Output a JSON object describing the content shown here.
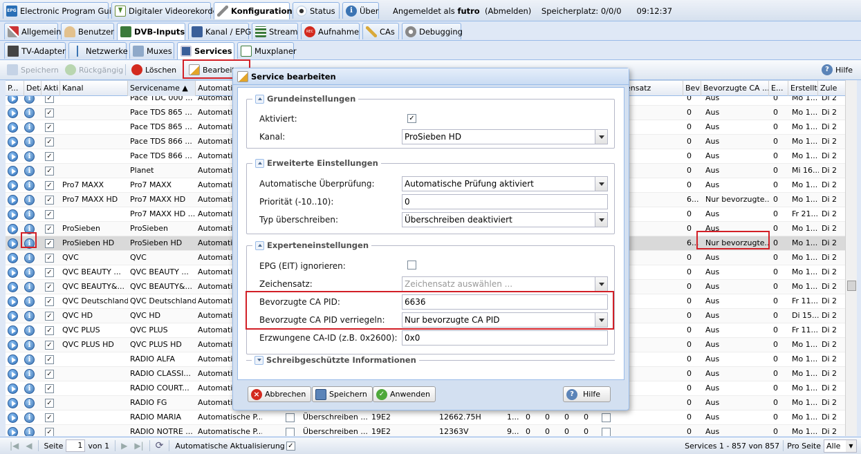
{
  "topnav": {
    "tabs": [
      {
        "label": "Electronic Program Guide",
        "icon": "epg-icon"
      },
      {
        "label": "Digitaler Videorekorder",
        "icon": "download-icon"
      },
      {
        "label": "Konfiguration",
        "icon": "wrench-icon"
      },
      {
        "label": "Status",
        "icon": "eye-icon"
      },
      {
        "label": "Über",
        "icon": "info-icon"
      }
    ],
    "logged_in": "Angemeldet als",
    "user": "futro",
    "logout": "(Abmelden)",
    "storage": "Speicherplatz: 0/0/0",
    "time": "09:12:37"
  },
  "config_tabs": [
    "Allgemein",
    "Benutzer",
    "DVB-Inputs",
    "Kanal / EPG",
    "Stream",
    "Aufnahme",
    "CAs",
    "Debugging"
  ],
  "dvb_tabs": [
    "TV-Adapter",
    "Netzwerke",
    "Muxes",
    "Services",
    "Muxplaner"
  ],
  "toolbar": {
    "save": "Speichern",
    "undo": "Rückgängig",
    "delete": "Löschen",
    "edit": "Bearbeiten",
    "help": "Hilfe"
  },
  "columns": [
    "P...",
    "Deta",
    "Akti",
    "Kanal",
    "Servicename ▲",
    "Automatis",
    "",
    "",
    "",
    "",
    "",
    "",
    "",
    "",
    "chensatz",
    "Bev",
    "Bevorzugte CA ...",
    "E...",
    "Erstellt",
    "Zule"
  ],
  "rows": [
    {
      "kanal": "",
      "service": "Pace TDC 000 ...",
      "auto": "Automatis",
      "bev": "0",
      "ca": "Aus",
      "e": "0",
      "erst": "Mo 1...",
      "zul": "Di 2"
    },
    {
      "kanal": "",
      "service": "Pace TDS 865 ...",
      "auto": "Automatis",
      "bev": "0",
      "ca": "Aus",
      "e": "0",
      "erst": "Mo 1...",
      "zul": "Di 2"
    },
    {
      "kanal": "",
      "service": "Pace TDS 865 ...",
      "auto": "Automatis",
      "bev": "0",
      "ca": "Aus",
      "e": "0",
      "erst": "Mo 1...",
      "zul": "Di 2"
    },
    {
      "kanal": "",
      "service": "Pace TDS 866 ...",
      "auto": "Automatis",
      "bev": "0",
      "ca": "Aus",
      "e": "0",
      "erst": "Mo 1...",
      "zul": "Di 2"
    },
    {
      "kanal": "",
      "service": "Pace TDS 866 ...",
      "auto": "Automatis",
      "bev": "0",
      "ca": "Aus",
      "e": "0",
      "erst": "Mo 1...",
      "zul": "Di 2"
    },
    {
      "kanal": "",
      "service": "Planet",
      "auto": "Automatis",
      "bev": "0",
      "ca": "Aus",
      "e": "0",
      "erst": "Mi 16...",
      "zul": "Di 2"
    },
    {
      "kanal": "Pro7 MAXX",
      "service": "Pro7 MAXX",
      "auto": "Automatis",
      "bev": "0",
      "ca": "Aus",
      "e": "0",
      "erst": "Mo 1...",
      "zul": "Di 2"
    },
    {
      "kanal": "Pro7 MAXX HD",
      "service": "Pro7 MAXX HD",
      "auto": "Automatis",
      "bev": "6...",
      "ca": "Nur bevorzugte...",
      "e": "0",
      "erst": "Mo 1...",
      "zul": "Di 2"
    },
    {
      "kanal": "",
      "service": "Pro7 MAXX HD ...",
      "auto": "Automatis",
      "bev": "0",
      "ca": "Aus",
      "e": "0",
      "erst": "Fr 21...",
      "zul": "Di 2"
    },
    {
      "kanal": "ProSieben",
      "service": "ProSieben",
      "auto": "Automatis",
      "bev": "0",
      "ca": "Aus",
      "e": "0",
      "erst": "Mo 1...",
      "zul": "Di 2"
    },
    {
      "kanal": "ProSieben HD",
      "service": "ProSieben HD",
      "auto": "Automatis",
      "bev": "6...",
      "ca": "Nur bevorzugte...",
      "e": "0",
      "erst": "Mo 1...",
      "zul": "Di 2"
    },
    {
      "kanal": "QVC",
      "service": "QVC",
      "auto": "Automatis",
      "bev": "0",
      "ca": "Aus",
      "e": "0",
      "erst": "Mo 1...",
      "zul": "Di 2"
    },
    {
      "kanal": "QVC BEAUTY ...",
      "service": "QVC BEAUTY ...",
      "auto": "Automatis",
      "bev": "0",
      "ca": "Aus",
      "e": "0",
      "erst": "Mo 1...",
      "zul": "Di 2"
    },
    {
      "kanal": "QVC BEAUTY&...",
      "service": "QVC BEAUTY&...",
      "auto": "Automatis",
      "bev": "0",
      "ca": "Aus",
      "e": "0",
      "erst": "Mo 1...",
      "zul": "Di 2"
    },
    {
      "kanal": "QVC Deutschland",
      "service": "QVC Deutschland",
      "auto": "Automatis",
      "bev": "0",
      "ca": "Aus",
      "e": "0",
      "erst": "Fr 11...",
      "zul": "Di 2"
    },
    {
      "kanal": "QVC HD",
      "service": "QVC HD",
      "auto": "Automatis",
      "bev": "0",
      "ca": "Aus",
      "e": "0",
      "erst": "Di 15...",
      "zul": "Di 2"
    },
    {
      "kanal": "QVC PLUS",
      "service": "QVC PLUS",
      "auto": "Automatis",
      "bev": "0",
      "ca": "Aus",
      "e": "0",
      "erst": "Fr 11...",
      "zul": "Di 2"
    },
    {
      "kanal": "QVC PLUS HD",
      "service": "QVC PLUS HD",
      "auto": "Automatis",
      "bev": "0",
      "ca": "Aus",
      "e": "0",
      "erst": "Mo 1...",
      "zul": "Di 2"
    },
    {
      "kanal": "",
      "service": "RADIO ALFA",
      "auto": "Automatis",
      "bev": "0",
      "ca": "Aus",
      "e": "0",
      "erst": "Mo 1...",
      "zul": "Di 2"
    },
    {
      "kanal": "",
      "service": "RADIO CLASSI...",
      "auto": "Automatis",
      "bev": "0",
      "ca": "Aus",
      "e": "0",
      "erst": "Mo 1...",
      "zul": "Di 2"
    },
    {
      "kanal": "",
      "service": "RADIO COURT...",
      "auto": "Automatis",
      "bev": "0",
      "ca": "Aus",
      "e": "0",
      "erst": "Mo 1...",
      "zul": "Di 2"
    },
    {
      "kanal": "",
      "service": "RADIO FG",
      "auto": "Automatis",
      "bev": "0",
      "ca": "Aus",
      "e": "0",
      "erst": "Mo 1...",
      "zul": "Di 2"
    },
    {
      "kanal": "",
      "service": "RADIO MARIA",
      "auto": "Automatische P...",
      "type": "Überschreiben ...",
      "sat": "19E2",
      "freq": "12662.75H",
      "x": "1...",
      "n": [
        "0",
        "0",
        "0",
        "0"
      ],
      "bev": "0",
      "ca": "Aus",
      "e": "0",
      "erst": "Mo 1...",
      "zul": "Di 2"
    },
    {
      "kanal": "",
      "service": "RADIO NOTRE ...",
      "auto": "Automatische P...",
      "type": "Überschreiben ...",
      "sat": "19E2",
      "freq": "12363V",
      "x": "9...",
      "n": [
        "0",
        "0",
        "0",
        "0"
      ],
      "bev": "0",
      "ca": "Aus",
      "e": "0",
      "erst": "Mo 1...",
      "zul": "Di 2"
    }
  ],
  "pager": {
    "page_label": "Seite",
    "page": "1",
    "of": "von 1",
    "auto_refresh": "Automatische Aktualisierung",
    "summary": "Services 1 - 857 von 857",
    "per_page_label": "Pro Seite",
    "per_page": "Alle"
  },
  "dialog": {
    "title": "Service bearbeiten",
    "sections": {
      "basic": "Grundeinstellungen",
      "advanced": "Erweiterte Einstellungen",
      "expert": "Experteneinstellungen",
      "readonly": "Schreibgeschützte Informationen"
    },
    "fields": {
      "enabled_label": "Aktiviert:",
      "channel_label": "Kanal:",
      "channel": "ProSieben HD",
      "autocheck_label": "Automatische Überprüfung:",
      "autocheck": "Automatische Prüfung aktiviert",
      "priority_label": "Priorität (-10..10):",
      "priority": "0",
      "type_label": "Typ überschreiben:",
      "type": "Überschreiben deaktiviert",
      "epg_label": "EPG (EIT) ignorieren:",
      "charset_label": "Zeichensatz:",
      "charset_placeholder": "Zeichensatz auswählen ...",
      "capid_label": "Bevorzugte CA PID:",
      "capid": "6636",
      "capid_lock_label": "Bevorzugte CA PID verriegeln:",
      "capid_lock": "Nur bevorzugte CA PID",
      "caid_label": "Erzwungene CA-ID (z.B. 0x2600):",
      "caid": "0x0"
    },
    "buttons": {
      "cancel": "Abbrechen",
      "save": "Speichern",
      "apply": "Anwenden",
      "help": "Hilfe"
    }
  },
  "colors": {
    "highlight": "#d21f26",
    "accent": "#99bbe8",
    "selected_row": "#d9d9d9"
  }
}
